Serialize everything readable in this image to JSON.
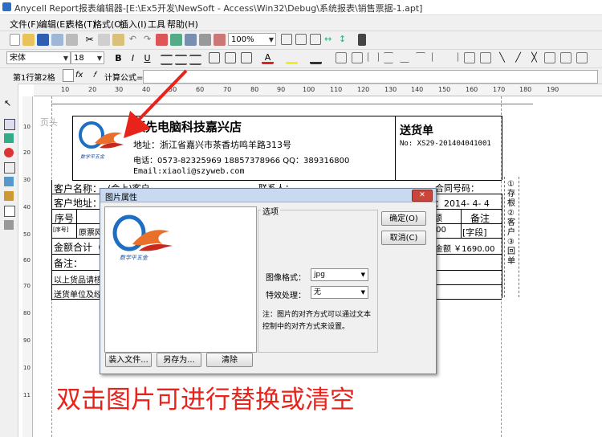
{
  "window": {
    "title": "Anycell Report报表编辑器-[E:\\Ex5开发\\NewSoft - Access\\Win32\\Debug\\系统报表\\销售票据-1.apt]"
  },
  "menu": [
    "文件(F)",
    "编辑(E)",
    "表格(T)",
    "格式(O)",
    "插入(I)",
    "工具",
    "帮助(H)"
  ],
  "toolbar": {
    "zoom": "100%",
    "font_name": "宋体",
    "font_size": "18",
    "bold": "B",
    "italic": "I",
    "underline": "U"
  },
  "formula_bar": {
    "cell_ref": "第1行第2格",
    "fx": "fx",
    "calc_label": "计算公式="
  },
  "ruler": {
    "ticks": [
      "10",
      "20",
      "30",
      "40",
      "50",
      "60",
      "70",
      "80",
      "90",
      "100",
      "110",
      "120",
      "130",
      "140",
      "150",
      "160",
      "170",
      "180",
      "190"
    ]
  },
  "vruler": {
    "ticks": [
      "10",
      "20",
      "30",
      "40",
      "50",
      "60",
      "70",
      "80",
      "90",
      "10",
      "11"
    ]
  },
  "report": {
    "band_label": "页头",
    "company": "领先电脑科技嘉兴店",
    "address": "地址：浙江省嘉兴市茶香坊鸣羊路313号",
    "phone": "电话：0573-82325969 18857378966 QQ：389316800",
    "email": "Email:xiaoli@szyweb.com",
    "doc_title": "送货单",
    "doc_no": "No: XS29-201404041001",
    "customer_name": "客户名称：",
    "customer_name_val": "(会上)客户",
    "contact": "联系人：",
    "contract": "合同号码：",
    "customer_addr": "客户地址：",
    "date": "：2014- 4- 4",
    "col_seq": "序号",
    "col_amount_tail": "额",
    "col_remark": "备注",
    "row_seq": "[序号]",
    "row_name": "原票网",
    "row_amount": ".00",
    "row_remark": "[字段]",
    "total_label": "金额合计（",
    "total_amount": "金额 ￥1690.00",
    "remark_label": "备注：",
    "note1": "以上货品请核",
    "note2": "送货单位及经",
    "side_copies": "①存根②客户③回单"
  },
  "logo": {
    "caption": "数学平五金"
  },
  "dialog": {
    "title": "图片属性",
    "options_group": "选项",
    "format_label": "图像格式：",
    "format_value": "jpg",
    "effect_label": "特效处理：",
    "effect_value": "无",
    "note": "注：图片的对齐方式可以通过文本控制中的对齐方式来设置。",
    "ok": "确定(O)",
    "cancel": "取消(C)",
    "import": "装入文件...",
    "save_as": "另存为...",
    "clear": "清除"
  },
  "annotation": {
    "caption": "双击图片可进行替换或清空"
  },
  "colors": {
    "accent": "#e8231b",
    "dialog_title": "#c9daf0"
  }
}
